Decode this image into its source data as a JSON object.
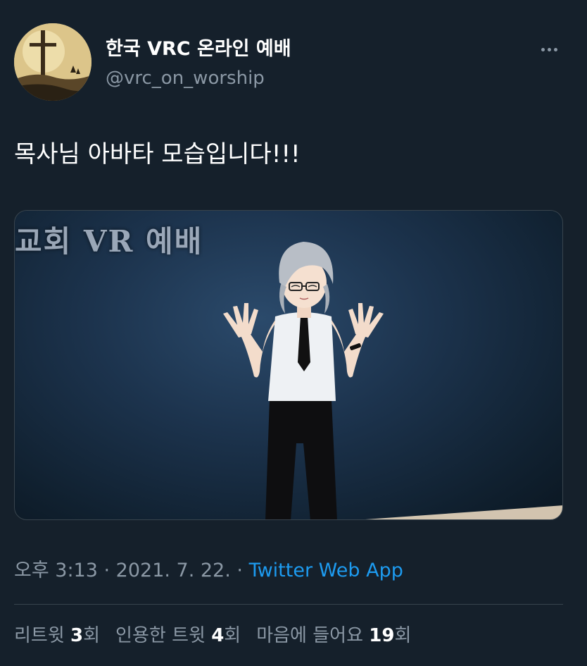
{
  "profile": {
    "display_name": "한국 VRC 온라인 예배",
    "handle": "@vrc_on_worship",
    "avatar_icon": "cross-sunset-avatar"
  },
  "menu": {
    "icon": "more-horizontal-icon"
  },
  "tweet": {
    "text": "목사님 아바타 모습입니다!!!"
  },
  "media": {
    "caption": "교회 VR 예배",
    "description_icon": "pastor-avatar-image"
  },
  "meta": {
    "time": "오후 3:13",
    "separator1": " · ",
    "date": "2021. 7. 22.",
    "separator2": " · ",
    "source": "Twitter Web App"
  },
  "stats": {
    "retweets_label": "리트윗 ",
    "retweets_count": "3",
    "retweets_suffix": "회",
    "quotes_label": "인용한 트윗 ",
    "quotes_count": "4",
    "quotes_suffix": "회",
    "likes_label": "마음에 들어요 ",
    "likes_count": "19",
    "likes_suffix": "회"
  },
  "colors": {
    "background": "#15202b",
    "secondary_text": "#8b98a5",
    "link": "#1d9bf0",
    "divider": "#38444d"
  }
}
